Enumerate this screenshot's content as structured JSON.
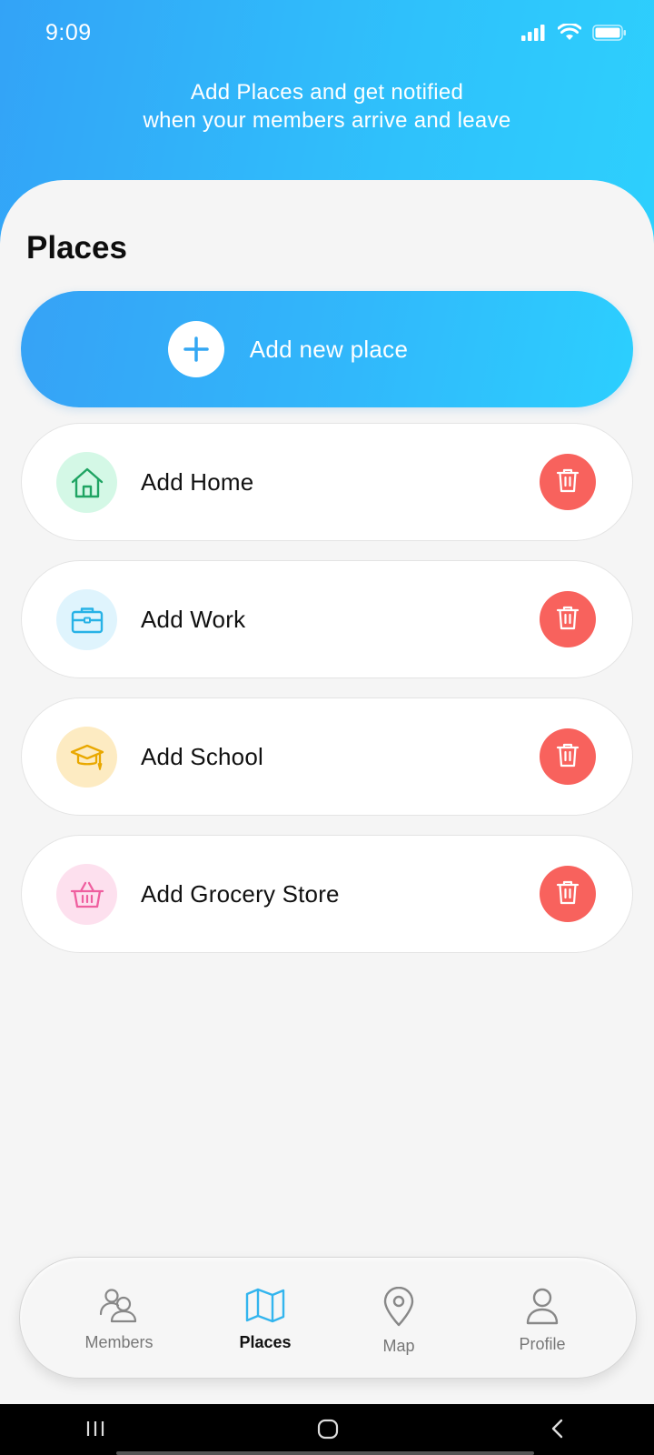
{
  "status_bar": {
    "time": "9:09",
    "icons": [
      "signal-icon",
      "wifi-icon",
      "battery-icon"
    ]
  },
  "header": {
    "message_line1": "Add Places and get notified",
    "message_line2": "when your members arrive and leave"
  },
  "page": {
    "title": "Places"
  },
  "add_new_place": {
    "label": "Add new place",
    "icon": "plus-icon"
  },
  "places": [
    {
      "label": "Add Home",
      "icon": "home-icon",
      "icon_color": "#1fa463",
      "bg_color": "#d4f8e6"
    },
    {
      "label": "Add Work",
      "icon": "briefcase-icon",
      "icon_color": "#27b2e6",
      "bg_color": "#dff4fd"
    },
    {
      "label": "Add School",
      "icon": "graduation-cap-icon",
      "icon_color": "#e9a800",
      "bg_color": "#fdebc2"
    },
    {
      "label": "Add Grocery Store",
      "icon": "basket-icon",
      "icon_color": "#ef5f9f",
      "bg_color": "#fde0ee"
    }
  ],
  "delete_color": "#f8625d",
  "bottom_nav": {
    "items": [
      {
        "label": "Members",
        "icon": "members-icon",
        "active": false
      },
      {
        "label": "Places",
        "icon": "map-folded-icon",
        "active": true
      },
      {
        "label": "Map",
        "icon": "location-pin-icon",
        "active": false
      },
      {
        "label": "Profile",
        "icon": "person-icon",
        "active": false
      }
    ],
    "active_color": "#33b5ee"
  },
  "system_nav": [
    "recents-icon",
    "home-circle-icon",
    "back-icon"
  ]
}
